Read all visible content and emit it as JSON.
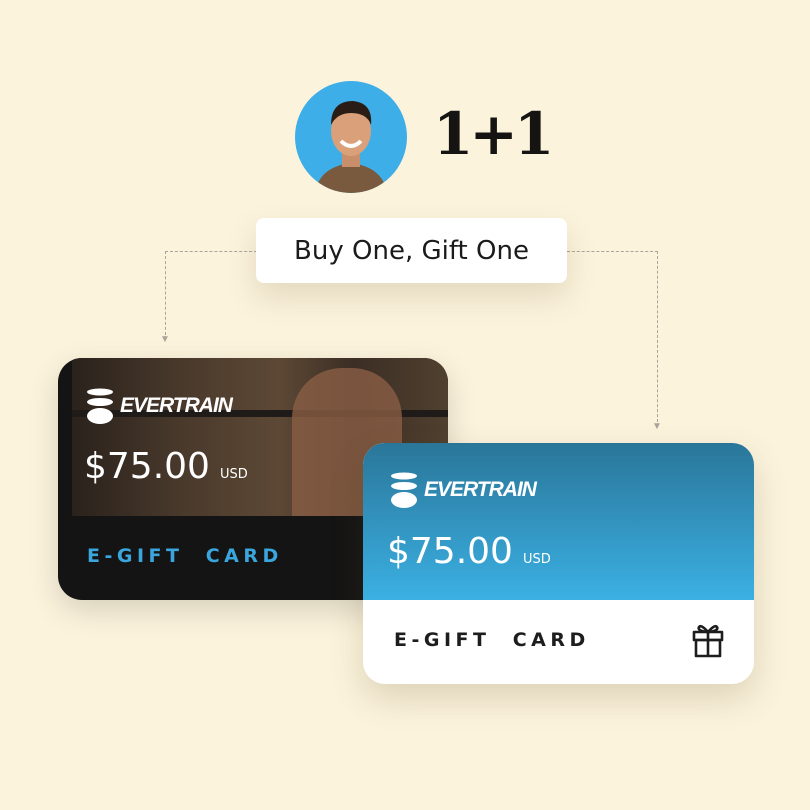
{
  "header": {
    "badge_text": "1+1",
    "promo_label": "Buy One, Gift One"
  },
  "cards": [
    {
      "brand": "EVERTRAIN",
      "amount": "$75.00",
      "currency": "USD",
      "type_label": "E-GIFT  CARD",
      "accent": "#3aa6dd"
    },
    {
      "brand": "EVERTRAIN",
      "amount": "$75.00",
      "currency": "USD",
      "type_label": "E-GIFT  CARD",
      "icon": "gift-icon",
      "accent": "#3bb0e3"
    }
  ],
  "colors": {
    "background": "#fbf3dc",
    "avatar_bg": "#3daee7"
  }
}
